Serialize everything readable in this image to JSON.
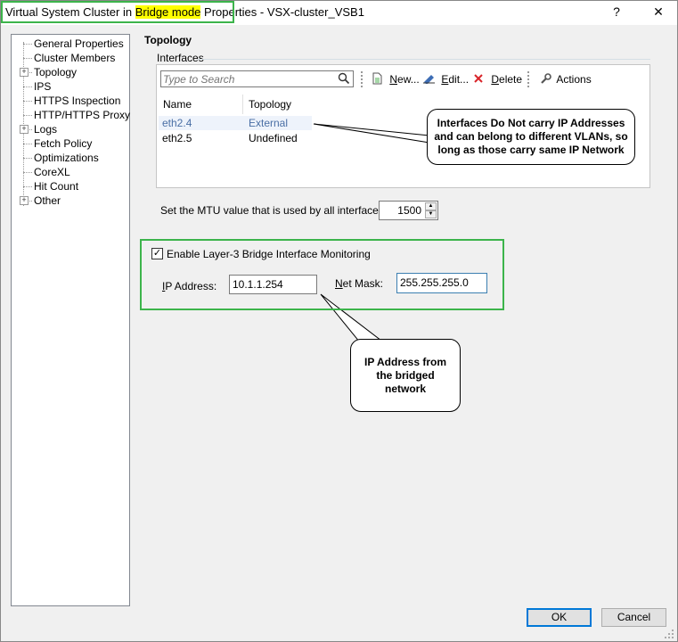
{
  "window": {
    "title_part1": "Virtual System Cluster in ",
    "title_highlight": "Bridge mode",
    "title_part2": " Properties - VSX-cluster_VSB1",
    "help_label": "?",
    "close_label": "✕"
  },
  "tree": {
    "items": [
      {
        "label": "General Properties",
        "expandable": false
      },
      {
        "label": "Cluster Members",
        "expandable": false
      },
      {
        "label": "Topology",
        "expandable": true
      },
      {
        "label": "IPS",
        "expandable": false
      },
      {
        "label": "HTTPS Inspection",
        "expandable": false
      },
      {
        "label": "HTTP/HTTPS Proxy",
        "expandable": false
      },
      {
        "label": "Logs",
        "expandable": true
      },
      {
        "label": "Fetch Policy",
        "expandable": false
      },
      {
        "label": "Optimizations",
        "expandable": false
      },
      {
        "label": "CoreXL",
        "expandable": false
      },
      {
        "label": "Hit Count",
        "expandable": false
      },
      {
        "label": "Other",
        "expandable": true
      }
    ]
  },
  "topology": {
    "heading": "Topology",
    "interfaces_label": "Interfaces",
    "search_placeholder": "Type to Search",
    "toolbar": {
      "new_mnemonic": "N",
      "new_rest": "ew...",
      "edit_mnemonic": "E",
      "edit_rest": "dit...",
      "delete_mnemonic": "D",
      "delete_rest": "elete",
      "actions_label": "Actions"
    },
    "columns": [
      "Name",
      "Topology"
    ],
    "rows": [
      {
        "name": "eth2.4",
        "topology": "External",
        "selected": true
      },
      {
        "name": "eth2.5",
        "topology": "Undefined",
        "selected": false
      }
    ],
    "mtu_label": "Set the MTU value that is used by all interfaces:",
    "mtu_value": "1500"
  },
  "monitoring": {
    "checkbox_label": "Enable Layer-3 Bridge Interface Monitoring",
    "checked": true,
    "ip_label_mnemonic": "I",
    "ip_label_rest": "P Address:",
    "ip_value": "10.1.1.254",
    "mask_label_mnemonic": "N",
    "mask_label_rest": "et Mask:",
    "mask_value": "255.255.255.0"
  },
  "callouts": {
    "interfaces_note": "Interfaces Do Not carry IP Addresses and can belong to different VLANs, so long as those carry same IP Network",
    "ip_note": "IP Address from the bridged network"
  },
  "buttons": {
    "ok": "OK",
    "cancel": "Cancel"
  },
  "colors": {
    "highlight_box": "#3cb44b",
    "title_highlight": "#ffff00",
    "selected_text": "#4a6fa5",
    "delete_icon": "#d9252a"
  }
}
